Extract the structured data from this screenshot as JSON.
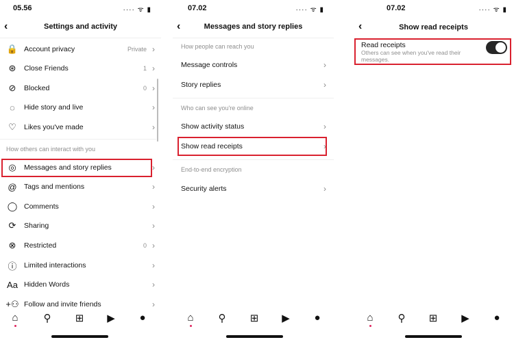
{
  "screens": [
    {
      "time": "05.56",
      "title": "Settings and activity",
      "rows": [
        {
          "icon": "lock-icon",
          "glyph": "🔒",
          "label": "Account privacy",
          "value": "Private"
        },
        {
          "icon": "close-friends-icon",
          "glyph": "⊛",
          "label": "Close Friends",
          "value": "1"
        },
        {
          "icon": "blocked-icon",
          "glyph": "⊘",
          "label": "Blocked",
          "value": "0"
        },
        {
          "icon": "hide-story-icon",
          "glyph": "◌",
          "label": "Hide story and live",
          "value": ""
        },
        {
          "icon": "heart-icon",
          "glyph": "♡",
          "label": "Likes you've made",
          "value": ""
        },
        {
          "icon": "messenger-icon",
          "glyph": "◎",
          "label": "Messages and story replies",
          "value": ""
        },
        {
          "icon": "at-icon",
          "glyph": "@",
          "label": "Tags and mentions",
          "value": ""
        },
        {
          "icon": "comment-icon",
          "glyph": "◯",
          "label": "Comments",
          "value": ""
        },
        {
          "icon": "sharing-icon",
          "glyph": "⟳",
          "label": "Sharing",
          "value": ""
        },
        {
          "icon": "restricted-icon",
          "glyph": "⊗",
          "label": "Restricted",
          "value": "0"
        },
        {
          "icon": "limited-icon",
          "glyph": "ⓘ",
          "label": "Limited interactions",
          "value": ""
        },
        {
          "icon": "hidden-words-icon",
          "glyph": "Aa",
          "label": "Hidden Words",
          "value": ""
        },
        {
          "icon": "add-person-icon",
          "glyph": "+⚇",
          "label": "Follow and invite friends",
          "value": ""
        }
      ],
      "headers": [
        "How others can interact with you"
      ]
    },
    {
      "time": "07.02",
      "title": "Messages and story replies",
      "headers": [
        "How people can reach you",
        "Who can see you're online",
        "End-to-end encryption"
      ],
      "rows": [
        {
          "label": "Message controls"
        },
        {
          "label": "Story replies"
        },
        {
          "label": "Show activity status"
        },
        {
          "label": "Show read receipts"
        },
        {
          "label": "Security alerts"
        }
      ]
    },
    {
      "time": "07.02",
      "title": "Show read receipts",
      "setting": {
        "label": "Read receipts",
        "description": "Others can see when you've read their messages.",
        "enabled": true
      }
    }
  ],
  "nav": [
    {
      "icon": "home-icon",
      "glyph": "⌂"
    },
    {
      "icon": "search-icon",
      "glyph": "⚲"
    },
    {
      "icon": "create-icon",
      "glyph": "⊞"
    },
    {
      "icon": "reels-icon",
      "glyph": "▶"
    },
    {
      "icon": "profile-icon",
      "glyph": "●"
    }
  ],
  "highlight_color": "#d9202e"
}
